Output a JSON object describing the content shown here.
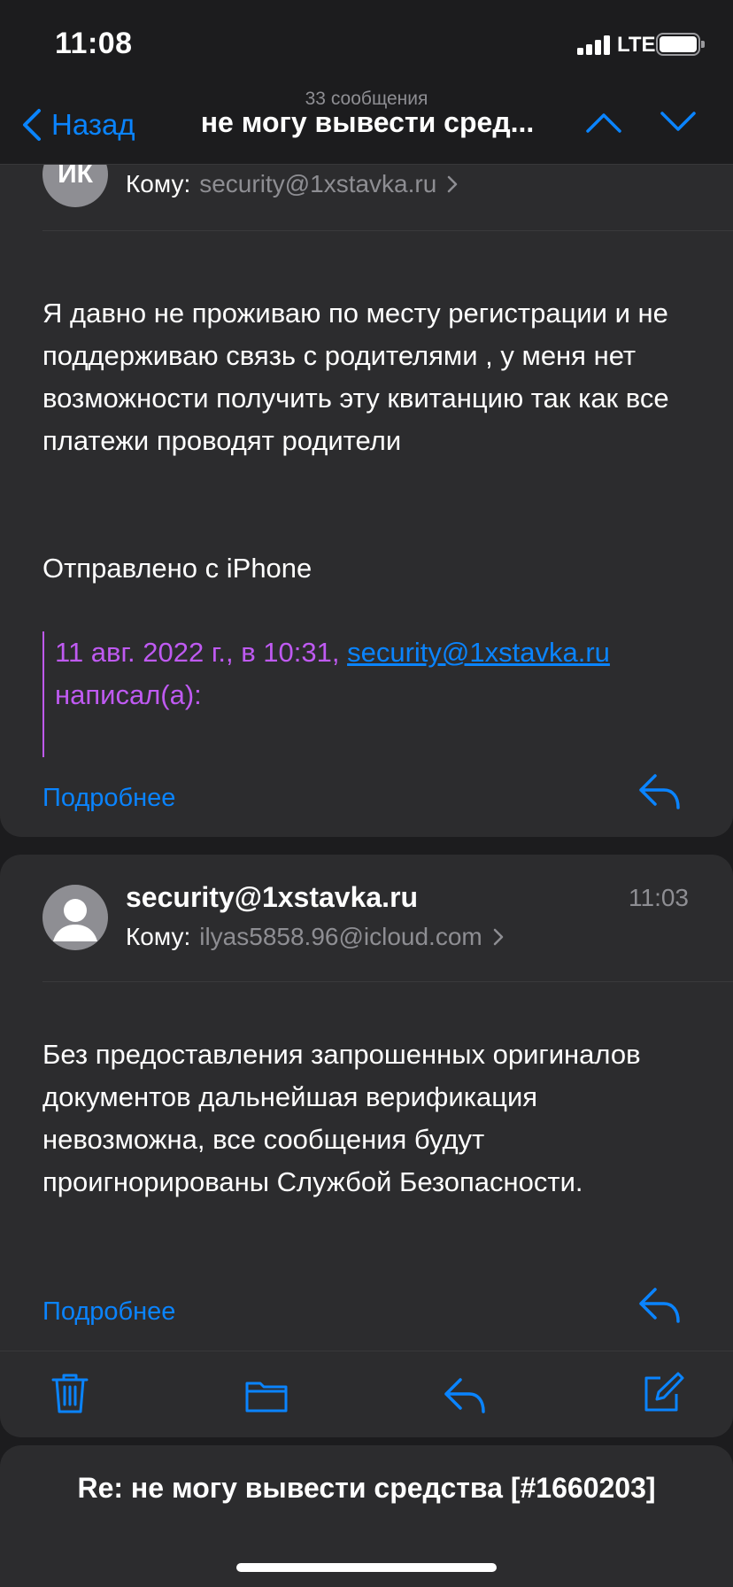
{
  "status_bar": {
    "time": "11:08",
    "network": "LTE"
  },
  "nav": {
    "back_label": "Назад",
    "message_count": "33 сообщения",
    "title": "не могу вывести сред..."
  },
  "messages": [
    {
      "avatar_initials": "ИК",
      "to_label": "Кому:",
      "to": "security@1xstavka.ru",
      "body": "Я давно не проживаю по месту регистрации и не поддерживаю связь с родителями , у меня нет возможности получить эту квитанцию так как все платежи проводят родители",
      "signature": "Отправлено с iPhone",
      "quote_prefix": "11 авг. 2022 г., в 10:31,",
      "quote_link": "security@1xstavka.ru",
      "quote_suffix": "написал(а):",
      "more_label": "Подробнее"
    },
    {
      "sender": "security@1xstavka.ru",
      "time": "11:03",
      "to_label": "Кому:",
      "to": "ilyas5858.96@icloud.com",
      "body": "Без предоставления запрошенных оригиналов документов дальнейшая верификация невозможна, все сообщения будут проигнорированы Службой Безопасности.",
      "more_label": "Подробнее"
    }
  ],
  "toolbar": {
    "icons": [
      "trash-icon",
      "folder-icon",
      "reply-icon",
      "compose-icon"
    ]
  },
  "draft": {
    "title": "Re: не могу вывести средства [#1660203]"
  },
  "colors": {
    "accent": "#0a84ff",
    "quote": "#bf5af2",
    "background": "#1c1c1e",
    "card": "#2c2c2e"
  }
}
